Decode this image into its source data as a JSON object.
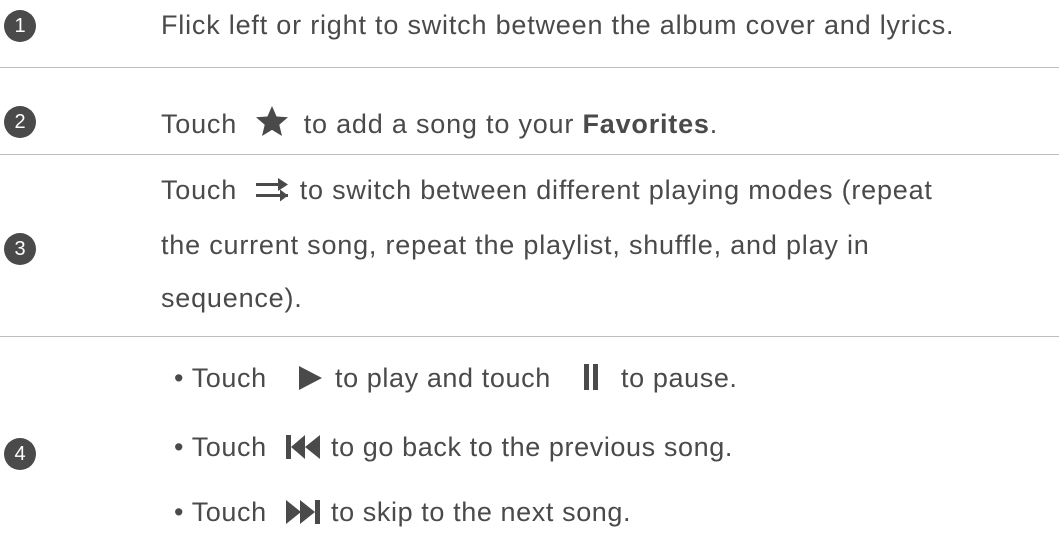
{
  "rows": [
    {
      "number": "1",
      "text": "Flick left or right to switch between the album cover and lyrics."
    },
    {
      "number": "2",
      "before": "Touch",
      "after": "to add a song to your",
      "bold": "Favorites",
      "end": "."
    },
    {
      "number": "3",
      "line1_before": "Touch",
      "line1_after": "to switch between different playing modes (repeat",
      "line2": "the current song, repeat the playlist, shuffle, and play in",
      "line3": "sequence)."
    },
    {
      "number": "4",
      "bullet": "•",
      "b1_before": "Touch",
      "b1_mid": "to play and touch",
      "b1_after": "to pause.",
      "b2_before": "Touch",
      "b2_after": "to go back to the previous song.",
      "b3_before": "Touch",
      "b3_after": "to skip to the next song."
    }
  ],
  "icons": [
    "star-icon",
    "playing-mode-icon",
    "play-icon",
    "pause-icon",
    "previous-icon",
    "next-icon"
  ],
  "colors": {
    "text": "#4a4a4a",
    "divider": "#bdbdbd"
  }
}
